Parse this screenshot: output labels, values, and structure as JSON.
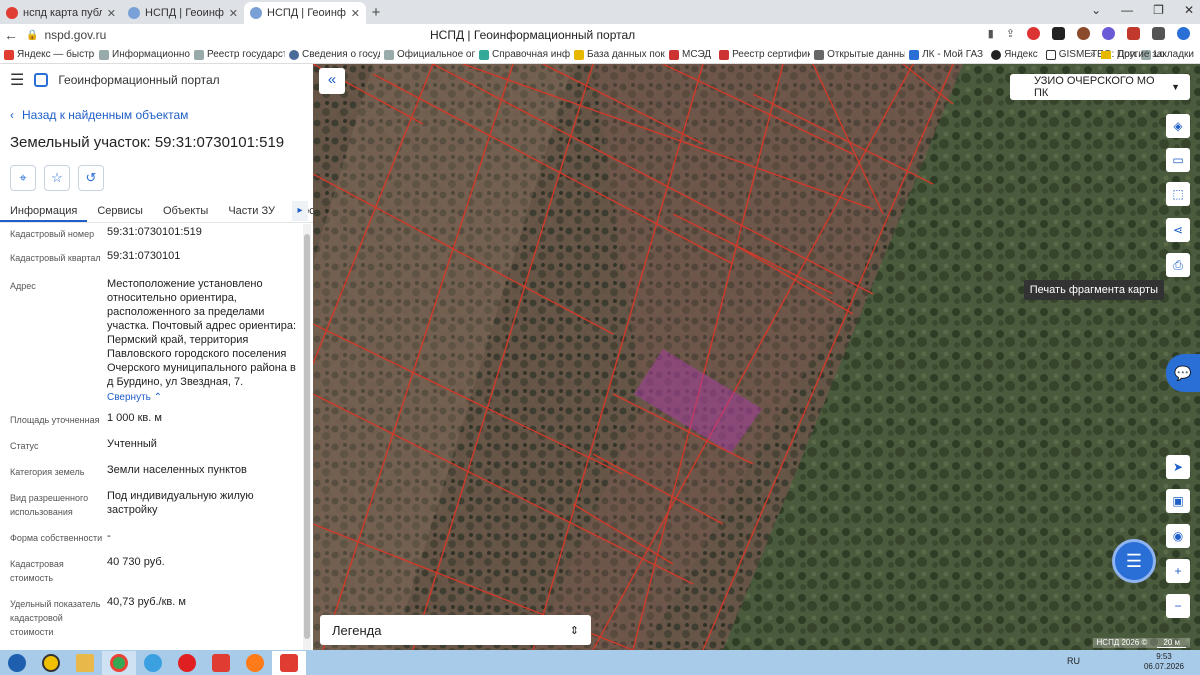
{
  "browser": {
    "tabs": [
      {
        "label": "нспд карта публичная кад"
      },
      {
        "label": "НСПД | Геоинформационн"
      },
      {
        "label": "НСПД | Геоинформацио"
      }
    ],
    "url": "nspd.gov.ru",
    "page_title": "НСПД | Геоинформационный портал",
    "bookmarks": [
      "Яндекс — быстрый",
      "Информационно",
      "Реестр государств",
      "Сведения о госуд",
      "Официальное опу",
      "Справочная инфо",
      "База данных пока",
      "МСЭД",
      "Реестр сертифика",
      "Открытые данные",
      "ЛК - Мой ГАЗ",
      "Яндекс",
      "GISMETEO: Погода",
      "Lo"
    ],
    "other_bookmarks": "Другие закладки"
  },
  "panel": {
    "app_title": "Геоинформационный портал",
    "back_label": "Назад к найденным объектам",
    "object_title": "Земельный участок: 59:31:0730101:519",
    "tabs": [
      "Информация",
      "Сервисы",
      "Объекты",
      "Части ЗУ",
      "Состав"
    ],
    "fields": [
      {
        "label": "Кадастровый номер",
        "value": "59:31:0730101:519"
      },
      {
        "label": "Кадастровый квартал",
        "value": "59:31:0730101"
      },
      {
        "label": "Адрес",
        "value": "Местоположение установлено относительно ориентира, расположенного за пределами участка. Почтовый адрес ориентира: Пермский край, территория Павловского городского поселения Очерского муниципального района в д Бурдино, ул Звездная, 7."
      },
      {
        "label": "Площадь уточненная",
        "value": "1 000 кв. м"
      },
      {
        "label": "Статус",
        "value": "Учтенный"
      },
      {
        "label": "Категория земель",
        "value": "Земли населенных пунктов"
      },
      {
        "label": "Вид разрешенного использования",
        "value": "Под индивидуальную жилую застройку"
      },
      {
        "label": "Форма собственности",
        "value": "-"
      },
      {
        "label": "Кадастровая стоимость",
        "value": "40 730 руб."
      },
      {
        "label": "Удельный показатель кадастровой стоимости",
        "value": "40,73 руб./кв. м"
      }
    ],
    "collapse_label": "Свернуть"
  },
  "map": {
    "region_select": "УЗИО ОЧЕРСКОГО МО ПК",
    "tooltip": "Печать фрагмента карты",
    "legend_label": "Легенда",
    "attribution": "НСПД 2026 ©",
    "scale": "20 м"
  },
  "taskbar": {
    "lang": "RU",
    "time": "9:53",
    "date": "06.07.2026"
  }
}
